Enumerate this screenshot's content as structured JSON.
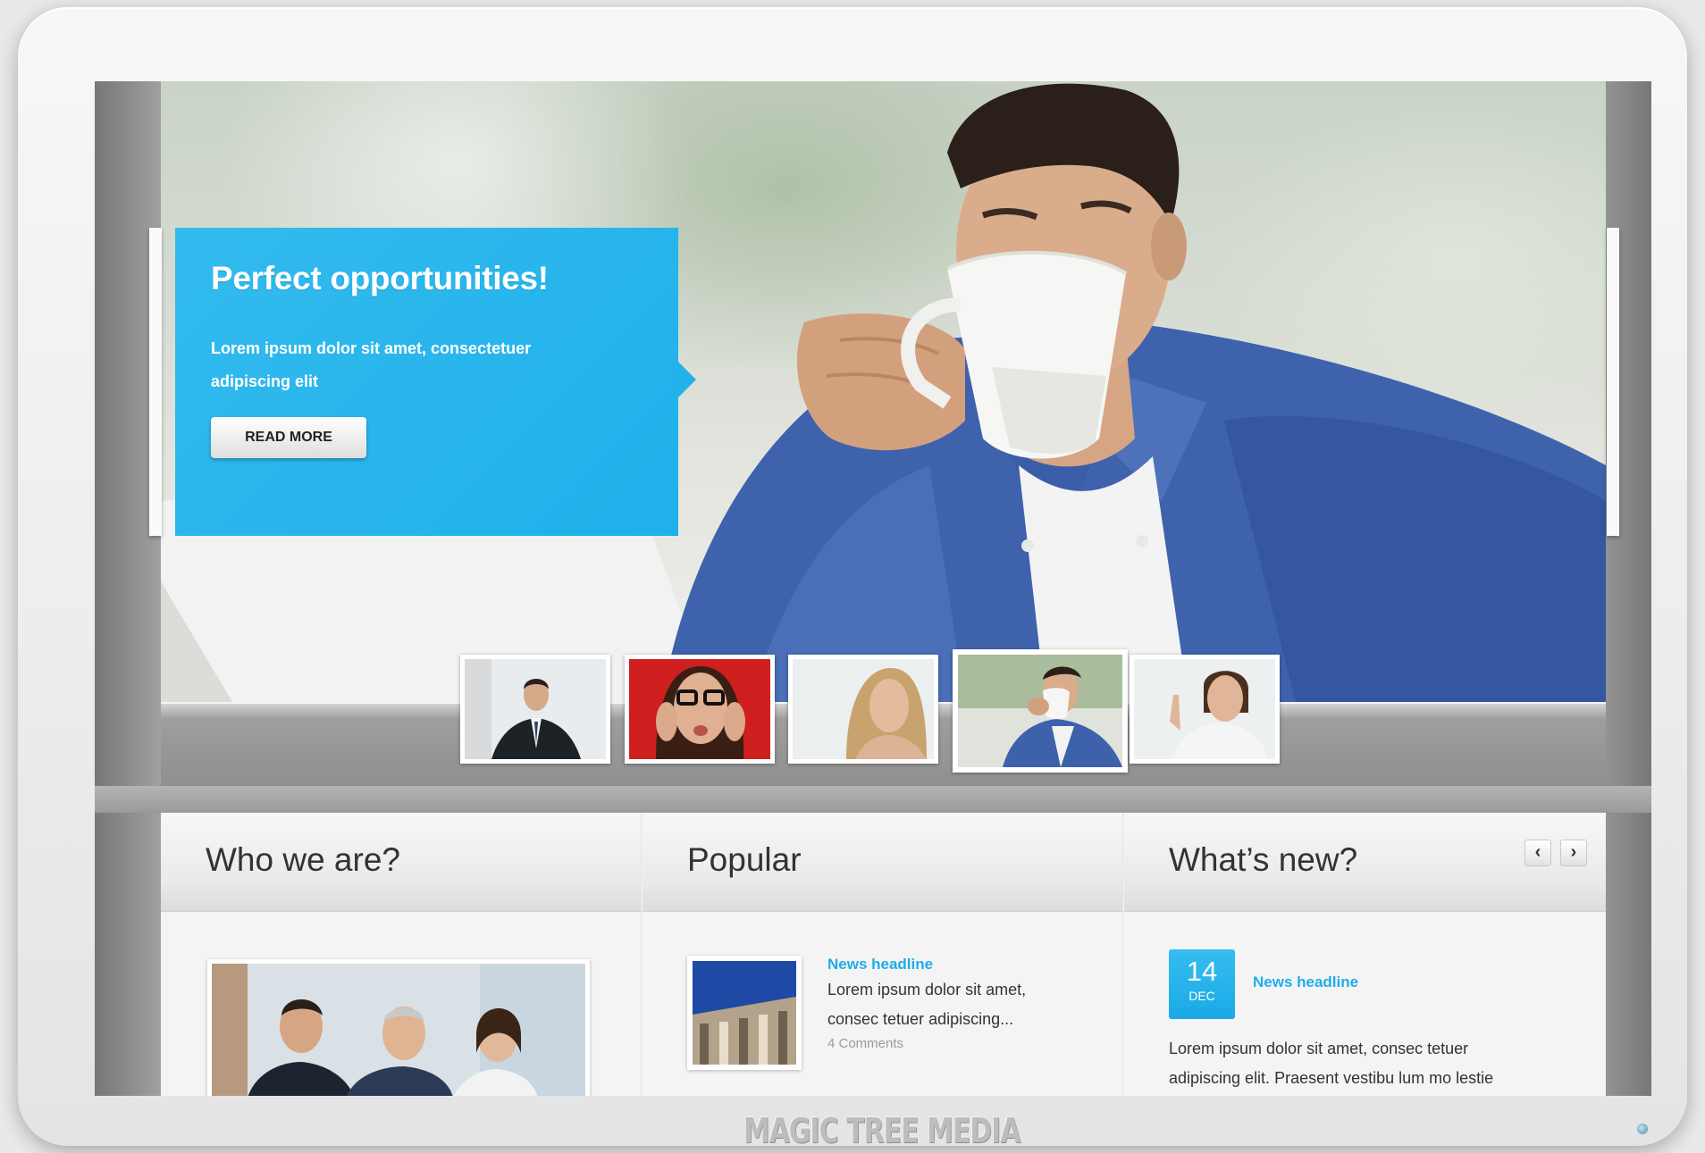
{
  "slider": {
    "caption_title": "Perfect opportunities!",
    "caption_text": "Lorem ipsum dolor sit amet, consectetuer adipiscing elit",
    "read_more_label": "READ MORE",
    "thumbnails": [
      "businessman-suit",
      "woman-glasses-red",
      "blonde-woman",
      "man-coffee-active",
      "woman-pointing"
    ],
    "active_thumbnail": 4
  },
  "columns": {
    "who": {
      "title": "Who we are?"
    },
    "popular": {
      "title": "Popular",
      "item": {
        "headline": "News headline",
        "text_line1": "Lorem ipsum dolor sit amet,",
        "text_line2": "consec tetuer adipiscing...",
        "comments": "4 Comments"
      }
    },
    "whats_new": {
      "title": "What’s new?",
      "prev_label": "‹",
      "next_label": "›",
      "item": {
        "day": "14",
        "month": "DEC",
        "headline": "News headline",
        "text_line1": "Lorem ipsum dolor sit amet, consec tetuer",
        "text_line2": "adipiscing elit. Praesent vestibu lum mo lestie"
      }
    }
  },
  "watermark": "MAGIC TREE MEDIA",
  "colors": {
    "accent": "#1fb0ea",
    "bezel": "#ececec"
  }
}
